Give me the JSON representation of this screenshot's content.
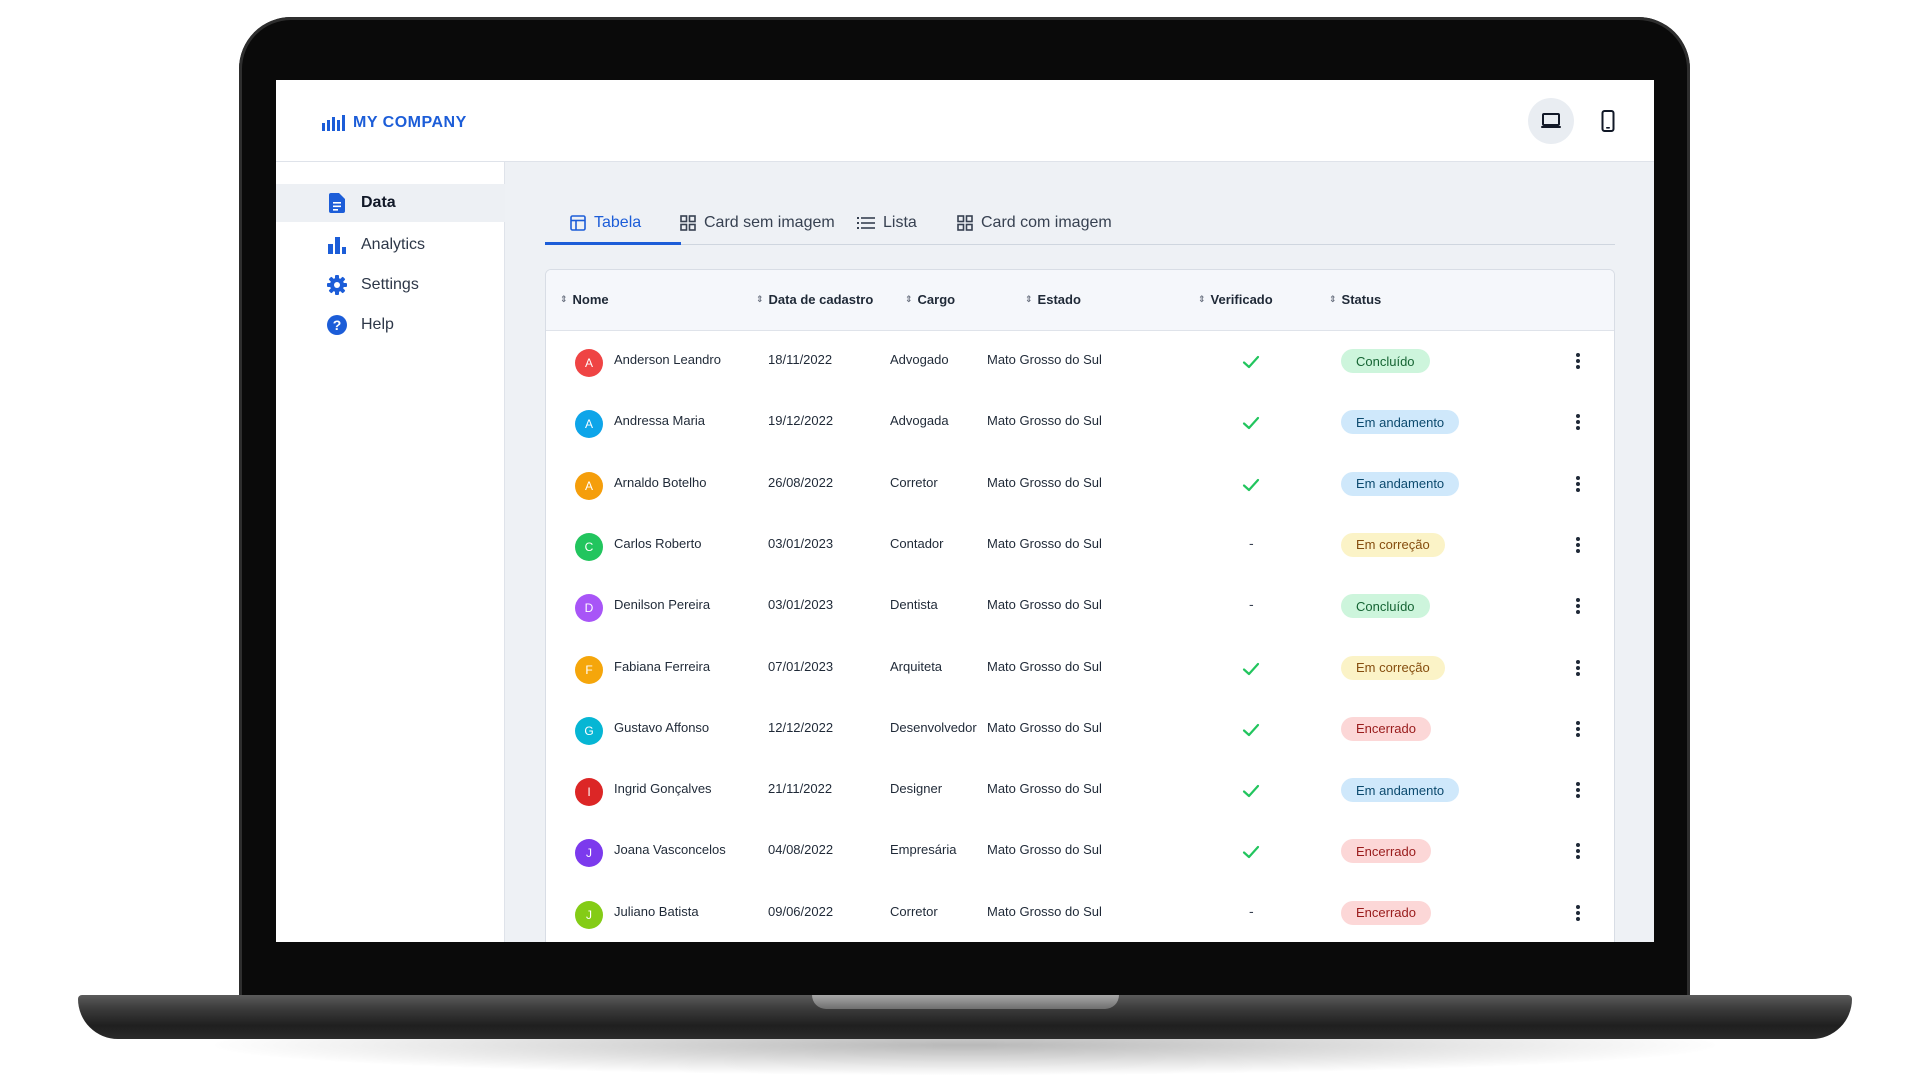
{
  "brand": {
    "name": "MY COMPANY",
    "color": "#1c5dd8"
  },
  "topbar": {
    "view_buttons": [
      {
        "icon": "laptop-icon",
        "selected": true
      },
      {
        "icon": "smartphone-icon",
        "selected": false
      }
    ]
  },
  "sidebar": {
    "items": [
      {
        "label": "Data",
        "icon": "document-icon",
        "active": true
      },
      {
        "label": "Analytics",
        "icon": "bar-chart-icon",
        "active": false
      },
      {
        "label": "Settings",
        "icon": "gear-icon",
        "active": false
      },
      {
        "label": "Help",
        "icon": "help-circle-icon",
        "active": false
      }
    ]
  },
  "tabs": [
    {
      "label": "Tabela",
      "icon": "table-icon",
      "active": true
    },
    {
      "label": "Card sem imagem",
      "icon": "grid-icon",
      "active": false
    },
    {
      "label": "Lista",
      "icon": "list-icon",
      "active": false
    },
    {
      "label": "Card com imagem",
      "icon": "grid-icon",
      "active": false
    }
  ],
  "table": {
    "columns": [
      "Nome",
      "Data de cadastro",
      "Cargo",
      "Estado",
      "Verificado",
      "Status"
    ],
    "rows": [
      {
        "initial": "A",
        "avatar_color": "#ef4444",
        "name": "Anderson Leandro",
        "date": "18/11/2022",
        "role": "Advogado",
        "state": "Mato Grosso do Sul",
        "verified": true,
        "status": "Concluído"
      },
      {
        "initial": "A",
        "avatar_color": "#0ea5e9",
        "name": "Andressa Maria",
        "date": "19/12/2022",
        "role": "Advogada",
        "state": "Mato Grosso do Sul",
        "verified": true,
        "status": "Em andamento"
      },
      {
        "initial": "A",
        "avatar_color": "#f59e0b",
        "name": "Arnaldo Botelho",
        "date": "26/08/2022",
        "role": "Corretor",
        "state": "Mato Grosso do Sul",
        "verified": true,
        "status": "Em andamento"
      },
      {
        "initial": "C",
        "avatar_color": "#22c55e",
        "name": "Carlos Roberto",
        "date": "03/01/2023",
        "role": "Contador",
        "state": "Mato Grosso do Sul",
        "verified": false,
        "status": "Em correção"
      },
      {
        "initial": "D",
        "avatar_color": "#a855f7",
        "name": "Denilson Pereira",
        "date": "03/01/2023",
        "role": "Dentista",
        "state": "Mato Grosso do Sul",
        "verified": false,
        "status": "Concluído"
      },
      {
        "initial": "F",
        "avatar_color": "#f5a60b",
        "name": "Fabiana Ferreira",
        "date": "07/01/2023",
        "role": "Arquiteta",
        "state": "Mato Grosso do Sul",
        "verified": true,
        "status": "Em correção"
      },
      {
        "initial": "G",
        "avatar_color": "#06b6d4",
        "name": "Gustavo Affonso",
        "date": "12/12/2022",
        "role": "Desenvolvedor",
        "state": "Mato Grosso do Sul",
        "verified": true,
        "status": "Encerrado"
      },
      {
        "initial": "I",
        "avatar_color": "#dc2626",
        "name": "Ingrid Gonçalves",
        "date": "21/11/2022",
        "role": "Designer",
        "state": "Mato Grosso do Sul",
        "verified": true,
        "status": "Em andamento"
      },
      {
        "initial": "J",
        "avatar_color": "#7c3aed",
        "name": "Joana Vasconcelos",
        "date": "04/08/2022",
        "role": "Empresária",
        "state": "Mato Grosso do Sul",
        "verified": true,
        "status": "Encerrado"
      },
      {
        "initial": "J",
        "avatar_color": "#84cc16",
        "name": "Juliano Batista",
        "date": "09/06/2022",
        "role": "Corretor",
        "state": "Mato Grosso do Sul",
        "verified": false,
        "status": "Encerrado"
      }
    ],
    "unverified_mark": "-"
  },
  "status_colors": {
    "Concluído": {
      "bg": "#cdf5dc",
      "fg": "#166534"
    },
    "Em andamento": {
      "bg": "#cfe8fb",
      "fg": "#0c4a6e"
    },
    "Em correção": {
      "bg": "#fbf3c7",
      "fg": "#854d0e"
    },
    "Encerrado": {
      "bg": "#fcd7d7",
      "fg": "#991b1b"
    }
  },
  "check_color": "#22c55e"
}
